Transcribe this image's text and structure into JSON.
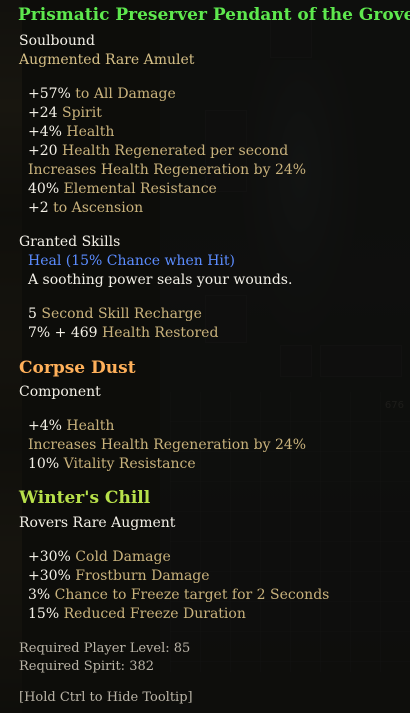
{
  "item": {
    "title": "Prismatic Preserver Pendant of the Grove",
    "binding": "Soulbound",
    "type": "Augmented Rare Amulet",
    "stats": [
      {
        "value": "+57%",
        "label": " to All Damage"
      },
      {
        "value": "+24",
        "label": " Spirit"
      },
      {
        "value": "+4%",
        "label": " Health"
      },
      {
        "value": "+20",
        "label": " Health Regenerated per second"
      },
      {
        "value": "",
        "label": "Increases Health Regeneration by 24%"
      },
      {
        "value": "40%",
        "label": " Elemental Resistance"
      },
      {
        "value": "+2",
        "label": " to Ascension"
      }
    ]
  },
  "granted": {
    "header": "Granted Skills",
    "skill": "Heal (15% Chance when Hit)",
    "desc": "A soothing power seals your wounds.",
    "recharge_value": "5",
    "recharge_label": " Second Skill Recharge",
    "restore_value": "7% + 469",
    "restore_label": " Health Restored"
  },
  "component": {
    "name": "Corpse Dust",
    "type": "Component",
    "stats": [
      {
        "value": "+4%",
        "label": " Health"
      },
      {
        "value": "",
        "label": "Increases Health Regeneration by 24%"
      },
      {
        "value": "10%",
        "label": " Vitality Resistance"
      }
    ]
  },
  "augment": {
    "name": "Winter's Chill",
    "type": "Rovers Rare Augment",
    "stats": [
      {
        "value": "+30%",
        "label": " Cold Damage"
      },
      {
        "value": "+30%",
        "label": " Frostburn Damage"
      },
      {
        "value": "3%",
        "label": " Chance to Freeze target for 2 Seconds"
      },
      {
        "value": "15%",
        "label": " Reduced Freeze Duration"
      }
    ]
  },
  "requirements": {
    "level": "Required Player Level: 85",
    "spirit": "Required Spirit: 382"
  },
  "hint": "[Hold Ctrl to Hide Tooltip]",
  "background_counter": "676"
}
